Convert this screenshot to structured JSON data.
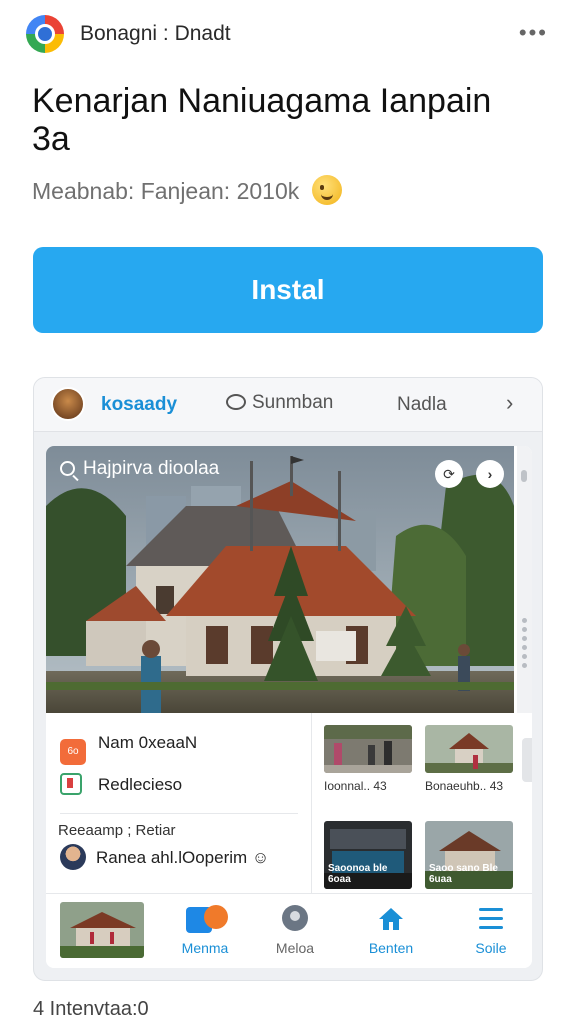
{
  "header": {
    "app_name": "Bonagni : Dnadt",
    "more_icon": "more-horizontal-icon"
  },
  "listing": {
    "title": "Kenarjan Naniuagama Ianpain 3a",
    "meta": "Meabnab: Fanjean: 2010k"
  },
  "install": {
    "label": "Instal",
    "color": "#27a8f0"
  },
  "tabs": {
    "active": "kosaady",
    "source": "Sunmban",
    "third": "Nadla",
    "next": "›"
  },
  "photo": {
    "search_text": "Hajpirva dioolaa",
    "btn1": "⟳",
    "btn2": "›"
  },
  "list": {
    "item1_icon": "6o",
    "item1": "Nam 0xeaaN",
    "item2": "Redlecieso",
    "section": "Reeaamp ; Retiar",
    "item4": "Ranea ahl.lOoperim ☺"
  },
  "thumbs": [
    {
      "caption": "Ioonnal.. 43"
    },
    {
      "caption": "Bonaeuhb.. 43"
    },
    {
      "overlay": "Saoonoa ble 6oaa"
    },
    {
      "overlay": "Saoo sano Ble 6uaa"
    }
  ],
  "bottom_nav": {
    "items": [
      {
        "label": "Menma"
      },
      {
        "label": "Meloa"
      },
      {
        "label": "Benten"
      },
      {
        "label": "Soile"
      }
    ]
  },
  "footer": {
    "text": "4 Intenvtaa:0"
  }
}
